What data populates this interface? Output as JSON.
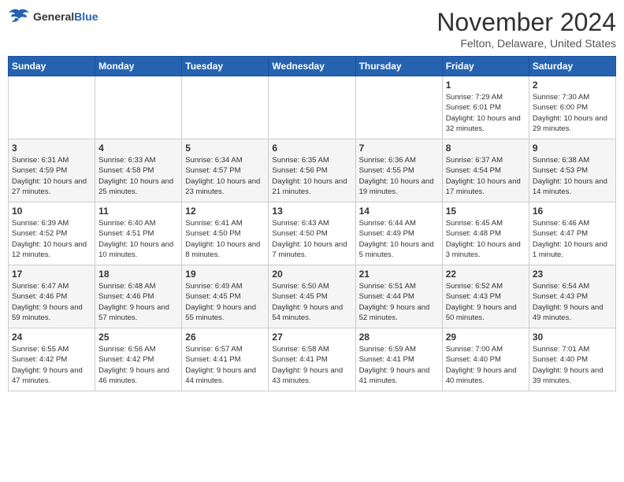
{
  "header": {
    "logo_general": "General",
    "logo_blue": "Blue",
    "month": "November 2024",
    "location": "Felton, Delaware, United States"
  },
  "weekdays": [
    "Sunday",
    "Monday",
    "Tuesday",
    "Wednesday",
    "Thursday",
    "Friday",
    "Saturday"
  ],
  "weeks": [
    [
      {
        "day": "",
        "info": ""
      },
      {
        "day": "",
        "info": ""
      },
      {
        "day": "",
        "info": ""
      },
      {
        "day": "",
        "info": ""
      },
      {
        "day": "",
        "info": ""
      },
      {
        "day": "1",
        "info": "Sunrise: 7:29 AM\nSunset: 6:01 PM\nDaylight: 10 hours and 32 minutes."
      },
      {
        "day": "2",
        "info": "Sunrise: 7:30 AM\nSunset: 6:00 PM\nDaylight: 10 hours and 29 minutes."
      }
    ],
    [
      {
        "day": "3",
        "info": "Sunrise: 6:31 AM\nSunset: 4:59 PM\nDaylight: 10 hours and 27 minutes."
      },
      {
        "day": "4",
        "info": "Sunrise: 6:33 AM\nSunset: 4:58 PM\nDaylight: 10 hours and 25 minutes."
      },
      {
        "day": "5",
        "info": "Sunrise: 6:34 AM\nSunset: 4:57 PM\nDaylight: 10 hours and 23 minutes."
      },
      {
        "day": "6",
        "info": "Sunrise: 6:35 AM\nSunset: 4:56 PM\nDaylight: 10 hours and 21 minutes."
      },
      {
        "day": "7",
        "info": "Sunrise: 6:36 AM\nSunset: 4:55 PM\nDaylight: 10 hours and 19 minutes."
      },
      {
        "day": "8",
        "info": "Sunrise: 6:37 AM\nSunset: 4:54 PM\nDaylight: 10 hours and 17 minutes."
      },
      {
        "day": "9",
        "info": "Sunrise: 6:38 AM\nSunset: 4:53 PM\nDaylight: 10 hours and 14 minutes."
      }
    ],
    [
      {
        "day": "10",
        "info": "Sunrise: 6:39 AM\nSunset: 4:52 PM\nDaylight: 10 hours and 12 minutes."
      },
      {
        "day": "11",
        "info": "Sunrise: 6:40 AM\nSunset: 4:51 PM\nDaylight: 10 hours and 10 minutes."
      },
      {
        "day": "12",
        "info": "Sunrise: 6:41 AM\nSunset: 4:50 PM\nDaylight: 10 hours and 8 minutes."
      },
      {
        "day": "13",
        "info": "Sunrise: 6:43 AM\nSunset: 4:50 PM\nDaylight: 10 hours and 7 minutes."
      },
      {
        "day": "14",
        "info": "Sunrise: 6:44 AM\nSunset: 4:49 PM\nDaylight: 10 hours and 5 minutes."
      },
      {
        "day": "15",
        "info": "Sunrise: 6:45 AM\nSunset: 4:48 PM\nDaylight: 10 hours and 3 minutes."
      },
      {
        "day": "16",
        "info": "Sunrise: 6:46 AM\nSunset: 4:47 PM\nDaylight: 10 hours and 1 minute."
      }
    ],
    [
      {
        "day": "17",
        "info": "Sunrise: 6:47 AM\nSunset: 4:46 PM\nDaylight: 9 hours and 59 minutes."
      },
      {
        "day": "18",
        "info": "Sunrise: 6:48 AM\nSunset: 4:46 PM\nDaylight: 9 hours and 57 minutes."
      },
      {
        "day": "19",
        "info": "Sunrise: 6:49 AM\nSunset: 4:45 PM\nDaylight: 9 hours and 55 minutes."
      },
      {
        "day": "20",
        "info": "Sunrise: 6:50 AM\nSunset: 4:45 PM\nDaylight: 9 hours and 54 minutes."
      },
      {
        "day": "21",
        "info": "Sunrise: 6:51 AM\nSunset: 4:44 PM\nDaylight: 9 hours and 52 minutes."
      },
      {
        "day": "22",
        "info": "Sunrise: 6:52 AM\nSunset: 4:43 PM\nDaylight: 9 hours and 50 minutes."
      },
      {
        "day": "23",
        "info": "Sunrise: 6:54 AM\nSunset: 4:43 PM\nDaylight: 9 hours and 49 minutes."
      }
    ],
    [
      {
        "day": "24",
        "info": "Sunrise: 6:55 AM\nSunset: 4:42 PM\nDaylight: 9 hours and 47 minutes."
      },
      {
        "day": "25",
        "info": "Sunrise: 6:56 AM\nSunset: 4:42 PM\nDaylight: 9 hours and 46 minutes."
      },
      {
        "day": "26",
        "info": "Sunrise: 6:57 AM\nSunset: 4:41 PM\nDaylight: 9 hours and 44 minutes."
      },
      {
        "day": "27",
        "info": "Sunrise: 6:58 AM\nSunset: 4:41 PM\nDaylight: 9 hours and 43 minutes."
      },
      {
        "day": "28",
        "info": "Sunrise: 6:59 AM\nSunset: 4:41 PM\nDaylight: 9 hours and 41 minutes."
      },
      {
        "day": "29",
        "info": "Sunrise: 7:00 AM\nSunset: 4:40 PM\nDaylight: 9 hours and 40 minutes."
      },
      {
        "day": "30",
        "info": "Sunrise: 7:01 AM\nSunset: 4:40 PM\nDaylight: 9 hours and 39 minutes."
      }
    ]
  ]
}
